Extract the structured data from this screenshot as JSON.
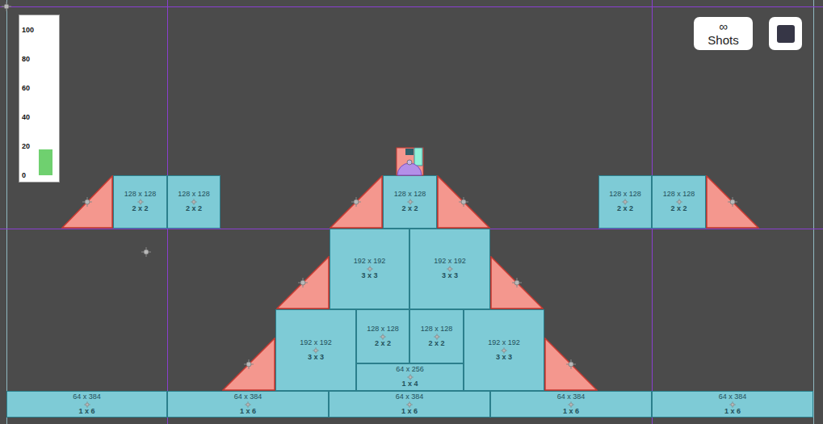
{
  "meter": {
    "ticks": [
      "100",
      "80",
      "60",
      "40",
      "20",
      "0"
    ],
    "level": 0.18
  },
  "shots": {
    "symbol": "∞",
    "label": "Shots"
  },
  "blocks": [
    {
      "kind": "ramp"
    },
    {
      "kind": "block",
      "label": "128 x 128",
      "grid": "2 x 2"
    },
    {
      "kind": "block",
      "label": "128 x 128",
      "grid": "2 x 2"
    },
    {
      "kind": "ramp"
    },
    {
      "kind": "block",
      "label": "128 x 128",
      "grid": "2 x 2"
    },
    {
      "kind": "ramp"
    },
    {
      "kind": "block",
      "label": "128 x 128",
      "grid": "2 x 2"
    },
    {
      "kind": "block",
      "label": "128 x 128",
      "grid": "2 x 2"
    },
    {
      "kind": "ramp"
    },
    {
      "kind": "ramp"
    },
    {
      "kind": "block",
      "label": "192 x 192",
      "grid": "3 x 3"
    },
    {
      "kind": "block",
      "label": "192 x 192",
      "grid": "3 x 3"
    },
    {
      "kind": "ramp"
    },
    {
      "kind": "ramp"
    },
    {
      "kind": "block",
      "label": "192 x 192",
      "grid": "3 x 3"
    },
    {
      "kind": "block",
      "label": "128 x 128",
      "grid": "2 x 2"
    },
    {
      "kind": "block",
      "label": "128 x 128",
      "grid": "2 x 2"
    },
    {
      "kind": "block",
      "label": "64 x 256",
      "grid": "1 x 4"
    },
    {
      "kind": "block",
      "label": "192 x 192",
      "grid": "3 x 3"
    },
    {
      "kind": "ramp"
    },
    {
      "kind": "block",
      "label": "64 x 384",
      "grid": "1 x 6"
    },
    {
      "kind": "block",
      "label": "64 x 384",
      "grid": "1 x 6"
    },
    {
      "kind": "block",
      "label": "64 x 384",
      "grid": "1 x 6"
    },
    {
      "kind": "block",
      "label": "64 x 384",
      "grid": "1 x 6"
    },
    {
      "kind": "block",
      "label": "64 x 384",
      "grid": "1 x 6"
    }
  ]
}
